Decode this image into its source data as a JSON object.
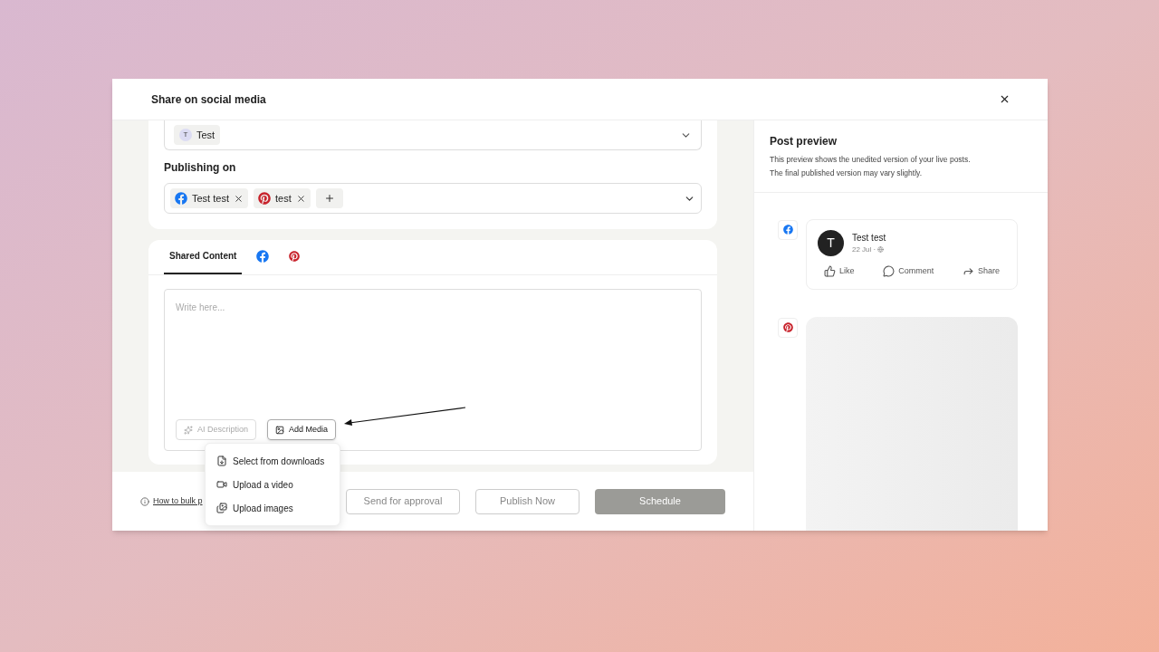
{
  "dialog": {
    "title": "Share on social media"
  },
  "account_select": {
    "chip_initial": "T",
    "chip_label": "Test"
  },
  "publishing": {
    "label": "Publishing on",
    "channels": [
      {
        "kind": "facebook",
        "label": "Test test"
      },
      {
        "kind": "pinterest",
        "label": "test"
      }
    ]
  },
  "content_tabs": [
    {
      "kind": "text",
      "label": "Shared Content",
      "selected": true
    },
    {
      "kind": "facebook",
      "selected": false
    },
    {
      "kind": "pinterest",
      "selected": false
    }
  ],
  "editor": {
    "placeholder": "Write here...",
    "actions": [
      {
        "kind": "ai",
        "label": "AI Description",
        "disabled": true
      },
      {
        "kind": "media",
        "label": "Add Media",
        "disabled": false
      }
    ]
  },
  "media_menu": [
    {
      "kind": "download",
      "label": "Select from downloads"
    },
    {
      "kind": "video",
      "label": "Upload a video"
    },
    {
      "kind": "images",
      "label": "Upload images"
    }
  ],
  "footer": {
    "help_link": "How to bulk p",
    "buttons": [
      {
        "label": "Send for approval",
        "kind": "outline"
      },
      {
        "label": "Publish Now",
        "kind": "outline"
      },
      {
        "label": "Schedule",
        "kind": "primary"
      }
    ]
  },
  "preview": {
    "title": "Post preview",
    "description": [
      "This preview shows the unedited version of your live posts.",
      "The final published version may vary slightly."
    ],
    "posts": [
      {
        "kind": "facebook",
        "author_initial": "T",
        "author": "Test test",
        "date": "22 Jul ·",
        "actions": [
          {
            "kind": "like",
            "label": "Like"
          },
          {
            "kind": "comment",
            "label": "Comment"
          },
          {
            "kind": "share",
            "label": "Share"
          }
        ]
      },
      {
        "kind": "pinterest"
      }
    ]
  }
}
